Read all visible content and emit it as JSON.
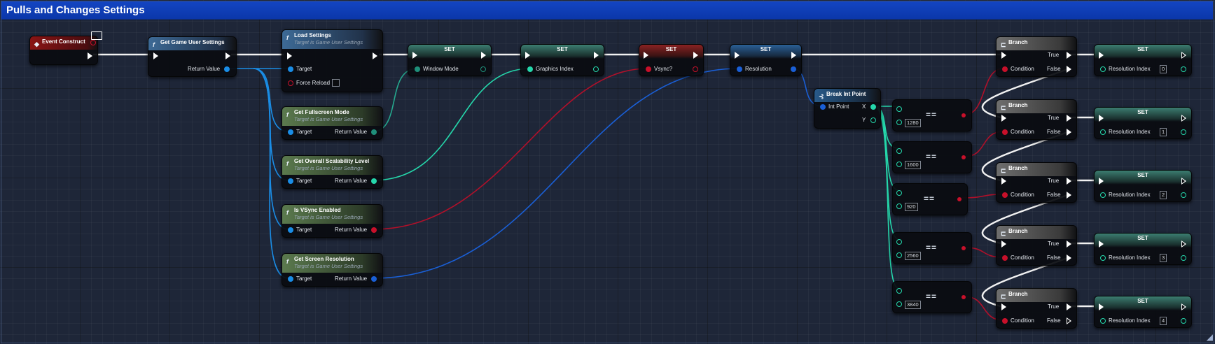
{
  "comment": {
    "title": "Pulls and Changes Settings"
  },
  "nodes": {
    "event_construct": {
      "title": "Event Construct"
    },
    "get_game_user_settings": {
      "title": "Get Game User Settings",
      "return_label": "Return Value"
    },
    "load_settings": {
      "title": "Load Settings",
      "subtitle": "Target is Game User Settings",
      "target_label": "Target",
      "force_reload_label": "Force Reload"
    },
    "get_fullscreen_mode": {
      "title": "Get Fullscreen Mode",
      "subtitle": "Target is Game User Settings",
      "target_label": "Target",
      "return_label": "Return Value"
    },
    "get_overall_scalability": {
      "title": "Get Overall Scalability Level",
      "subtitle": "Target is Game User Settings",
      "target_label": "Target",
      "return_label": "Return Value"
    },
    "is_vsync_enabled": {
      "title": "Is VSync Enabled",
      "subtitle": "Target is Game User Settings",
      "target_label": "Target",
      "return_label": "Return Value"
    },
    "get_screen_resolution": {
      "title": "Get Screen Resolution",
      "subtitle": "Target is Game User Settings",
      "target_label": "Target",
      "return_label": "Return Value"
    },
    "set_window_mode": {
      "title": "SET",
      "var_label": "Window Mode"
    },
    "set_graphics_index": {
      "title": "SET",
      "var_label": "Graphics Index"
    },
    "set_vsync": {
      "title": "SET",
      "var_label": "Vsync?"
    },
    "set_resolution": {
      "title": "SET",
      "var_label": "Resolution"
    },
    "break_int_point": {
      "title": "Break Int Point",
      "in_label": "Int Point",
      "x_label": "X",
      "y_label": "Y"
    },
    "eq": [
      {
        "op": "==",
        "value": "1280"
      },
      {
        "op": "==",
        "value": "1600"
      },
      {
        "op": "==",
        "value": "920"
      },
      {
        "op": "==",
        "value": "2560"
      },
      {
        "op": "==",
        "value": "3840"
      }
    ],
    "branch": [
      {
        "title": "Branch",
        "true_label": "True",
        "cond_label": "Condition",
        "false_label": "False"
      },
      {
        "title": "Branch",
        "true_label": "True",
        "cond_label": "Condition",
        "false_label": "False"
      },
      {
        "title": "Branch",
        "true_label": "True",
        "cond_label": "Condition",
        "false_label": "False"
      },
      {
        "title": "Branch",
        "true_label": "True",
        "cond_label": "Condition",
        "false_label": "False"
      },
      {
        "title": "Branch",
        "true_label": "True",
        "cond_label": "Condition",
        "false_label": "False"
      }
    ],
    "set_res_index": [
      {
        "title": "SET",
        "label": "Resolution Index",
        "value": "0"
      },
      {
        "title": "SET",
        "label": "Resolution Index",
        "value": "1"
      },
      {
        "title": "SET",
        "label": "Resolution Index",
        "value": "2"
      },
      {
        "title": "SET",
        "label": "Resolution Index",
        "value": "3"
      },
      {
        "title": "SET",
        "label": "Resolution Index",
        "value": "4"
      }
    ]
  },
  "colors": {
    "comment_header": "#0b37aa",
    "object_pin": "#1a8de6",
    "int_pin": "#25d7ab",
    "bool_pin": "#c8102a",
    "struct_pin": "#1a5fd6",
    "exec_wire": "#ffffff"
  },
  "icons": {
    "event": "event-diamond-icon",
    "function": "function-f-icon",
    "branch": "branch-icon",
    "break": "break-struct-icon",
    "monitor": "monitor-icon"
  }
}
